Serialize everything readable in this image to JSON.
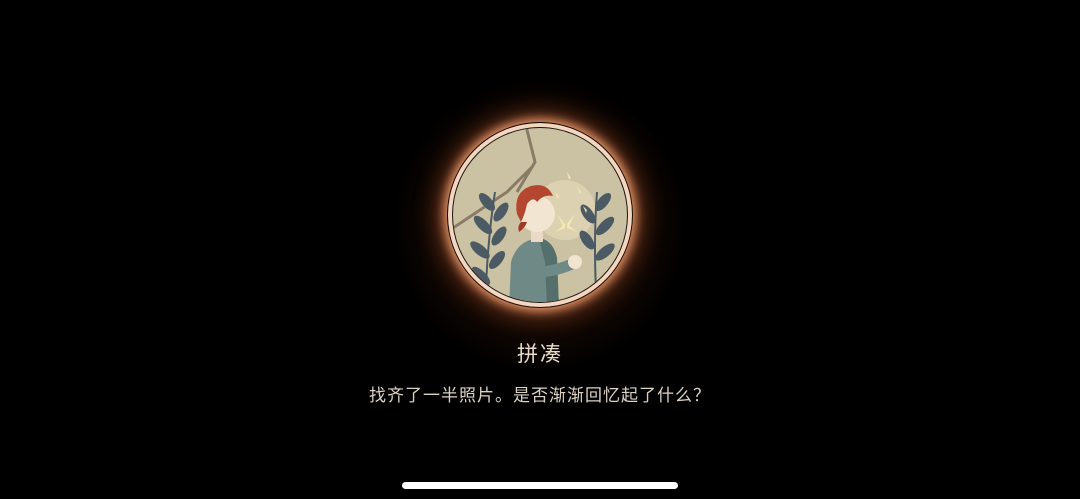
{
  "popup": {
    "title": "拼凑",
    "message": "找齐了一半照片。是否渐渐回忆起了什么？"
  },
  "medallion": {
    "illustration": "boy-with-butterfly-illustration",
    "ring_color": "#f3d8c0",
    "glow_color": "#e06a30",
    "background_color": "#cbc2a3"
  },
  "system": {
    "home_indicator": "home-indicator-bar"
  }
}
